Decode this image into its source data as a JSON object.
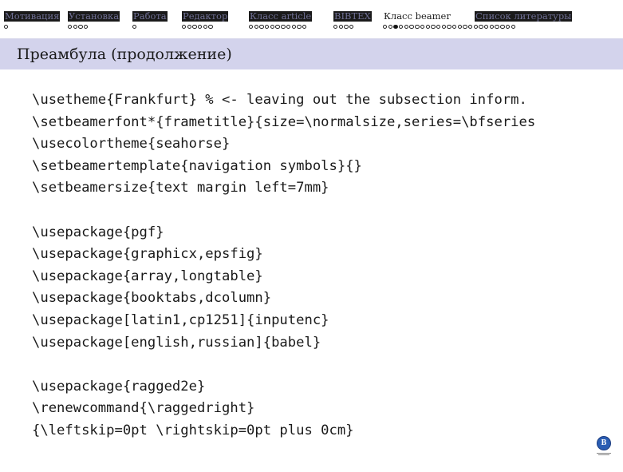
{
  "nav": {
    "sections": [
      {
        "title": "Мотивация",
        "active": false,
        "subsections": [
          {
            "dots": 1,
            "current_index": -1
          }
        ]
      },
      {
        "title": "Установка",
        "active": false,
        "subsections": [
          {
            "dots": 4,
            "current_index": -1
          }
        ]
      },
      {
        "title": "Работа",
        "active": false,
        "subsections": [
          {
            "dots": 1,
            "current_index": -1
          }
        ]
      },
      {
        "title": "Редактор",
        "active": false,
        "subsections": [
          {
            "dots": 6,
            "current_index": -1
          }
        ]
      },
      {
        "title": "Класс article",
        "active": false,
        "subsections": [
          {
            "dots": 11,
            "current_index": -1
          }
        ]
      },
      {
        "title": "BIBTEX",
        "active": false,
        "subsections": [
          {
            "dots": 4,
            "current_index": -1
          }
        ]
      },
      {
        "title": "Класс beamer",
        "active": true,
        "subsections": [
          {
            "dots": 25,
            "current_index": 2
          }
        ]
      },
      {
        "title": "Список литературы",
        "active": false,
        "subsections": []
      }
    ]
  },
  "frame": {
    "title": "Преамбула (продолжение)"
  },
  "code_lines": [
    "\\usetheme{Frankfurt} % <- leaving out the subsection inform.",
    "\\setbeamerfont*{frametitle}{size=\\normalsize,series=\\bfseries",
    "\\usecolortheme{seahorse}",
    "\\setbeamertemplate{navigation symbols}{}",
    "\\setbeamersize{text margin left=7mm}",
    "",
    "\\usepackage{pgf}",
    "\\usepackage{graphicx,epsfig}",
    "\\usepackage{array,longtable}",
    "\\usepackage{booktabs,dcolumn}",
    "\\usepackage[latin1,cp1251]{inputenc}",
    "\\usepackage[english,russian]{babel}",
    "",
    "\\usepackage{ragged2e}",
    "\\renewcommand{\\raggedright}",
    "{\\leftskip=0pt \\rightskip=0pt plus 0cm}"
  ],
  "logo": {
    "icon": "hse-logo-icon",
    "letter": "B",
    "color": "#2a5db3"
  },
  "colors": {
    "frametitle_bg": "#d3d3ec",
    "nav_inactive_bg": "#1a1a1a",
    "nav_inactive_text": "#6f6f94"
  }
}
